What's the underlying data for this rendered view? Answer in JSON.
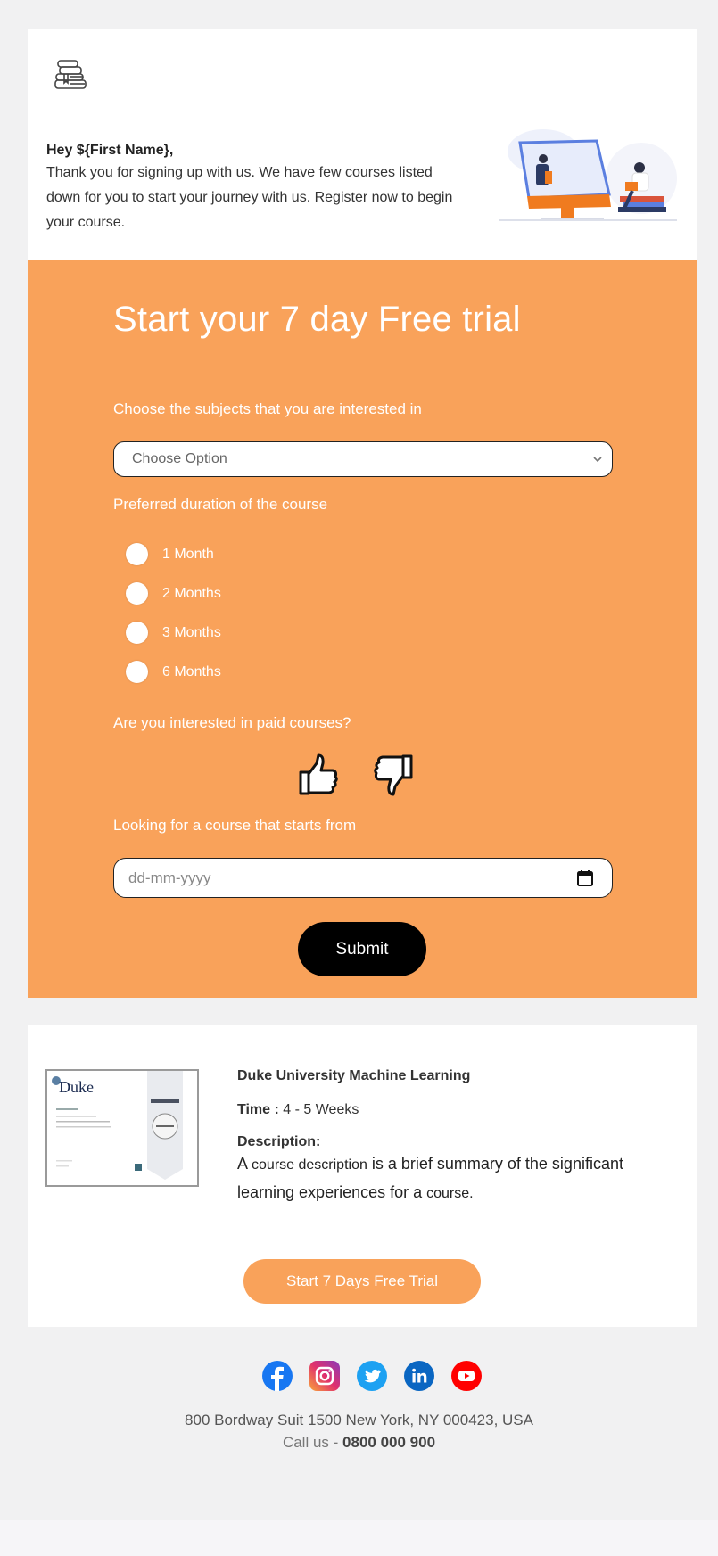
{
  "header": {
    "logo_icon": "stack-of-books-icon",
    "greeting": "Hey ${First Name},",
    "intro": "Thank you for signing up with us. We have few courses listed down for you to start your journey with us. Register now to begin your course.",
    "illustration": "online-learning-illustration"
  },
  "form": {
    "title": "Start your 7 day Free trial",
    "subjects_label": "Choose the subjects that you are interested in",
    "subjects_select": {
      "selected": "Choose Option",
      "icon": "chevron-down-icon"
    },
    "duration_label": "Preferred duration of the course",
    "duration_options": [
      "1 Month",
      "2 Months",
      "3 Months",
      "6 Months"
    ],
    "paid_label": "Are you interested in paid courses?",
    "paid_icons": [
      "thumbs-up-icon",
      "thumbs-down-icon"
    ],
    "start_label": "Looking for a course that starts from",
    "date_placeholder": "dd-mm-yyyy",
    "date_icon": "calendar-icon",
    "submit_label": "Submit",
    "colors": {
      "panel": "#f9a25a",
      "submit_bg": "#000000"
    }
  },
  "course": {
    "thumbnail_text": "Duke",
    "title": "Duke University Machine Learning",
    "time_label": "Time :",
    "time_value": "4 - 5 Weeks",
    "description_label": "Description:",
    "description_parts": [
      "A ",
      "course description",
      " is a brief summary of the significant learning experiences for a ",
      "course",
      "."
    ],
    "cta_label": "Start 7 Days Free Trial"
  },
  "footer": {
    "social": [
      {
        "name": "facebook",
        "color": "#1877f2"
      },
      {
        "name": "instagram",
        "color": "#c13584"
      },
      {
        "name": "twitter",
        "color": "#1da1f2"
      },
      {
        "name": "linkedin",
        "color": "#0a66c2"
      },
      {
        "name": "youtube",
        "color": "#ff0000"
      }
    ],
    "address": "800 Bordway Suit 1500 New York, NY 000423, USA",
    "call_label": "Call us - ",
    "phone": "0800 000 900"
  }
}
